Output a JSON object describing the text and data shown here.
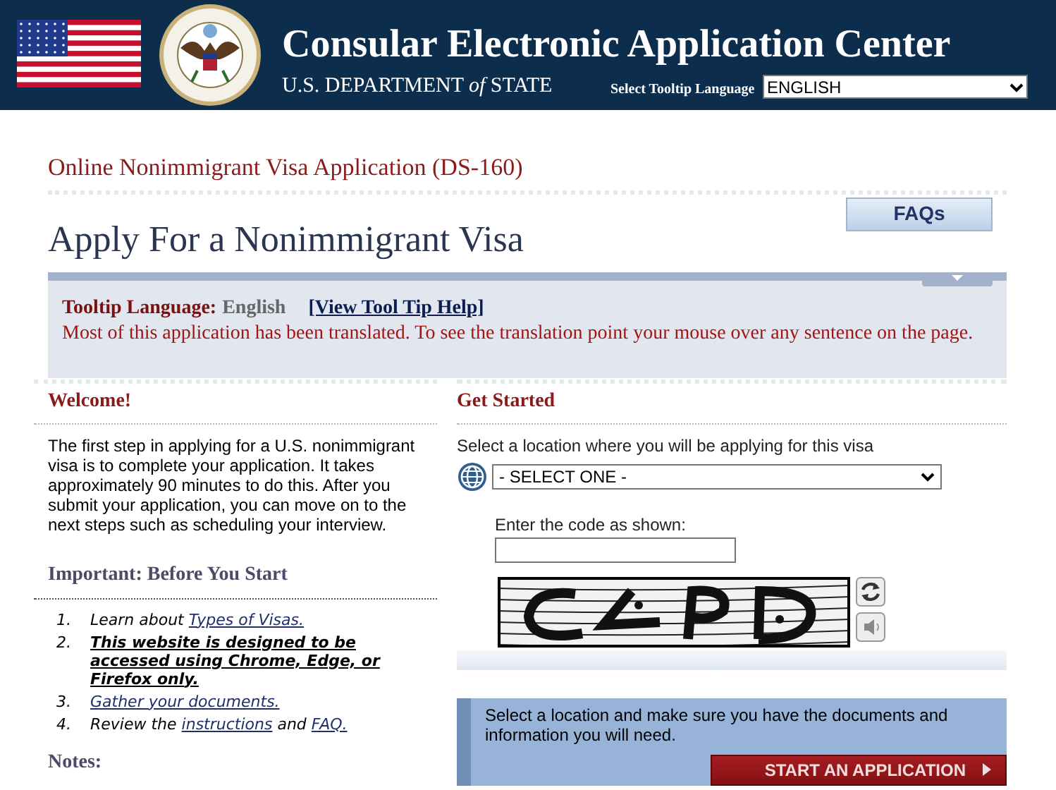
{
  "header": {
    "title": "Consular Electronic Application Center",
    "subtitle": "U.S. DEPARTMENT *of* STATE",
    "language_label": "Select Tooltip Language",
    "language_select": "ENGLISH"
  },
  "breadcrumb": "Online Nonimmigrant Visa Application (DS-160)",
  "page_title": "Apply For a Nonimmigrant Visa",
  "faqs_button": "FAQs",
  "tooltip_panel": {
    "label": "Tooltip Language:",
    "value": "English",
    "help_link": "[View Tool Tip Help]",
    "message": "Most of this application has been translated. To see the translation point your mouse over any sentence on the page."
  },
  "welcome": {
    "heading": "Welcome!",
    "text": "The first step in applying for a U.S. nonimmigrant visa is to complete your application. It takes approximately 90 minutes to do this. After you submit your application, you can move on to the next steps such as scheduling your interview.",
    "important_heading": "Important: Before You Start",
    "steps": [
      {
        "number": "1.",
        "parts": [
          {
            "kind": "text",
            "text": "Learn about "
          },
          {
            "kind": "link",
            "text": "Types of Visas."
          }
        ]
      },
      {
        "number": "2.",
        "parts": [
          {
            "kind": "bold_link",
            "text": "This website is designed to be accessed using Chrome, Edge, or Firefox only."
          }
        ]
      },
      {
        "number": "3.",
        "parts": [
          {
            "kind": "link",
            "text": "Gather your documents."
          }
        ]
      },
      {
        "number": "4.",
        "parts": [
          {
            "kind": "text",
            "text": "Review the "
          },
          {
            "kind": "link",
            "text": "instructions"
          },
          {
            "kind": "text",
            "text": " and "
          },
          {
            "kind": "link",
            "text": "FAQ."
          }
        ]
      }
    ],
    "notes_heading": "Notes:"
  },
  "get_started": {
    "heading": "Get Started",
    "location_label": "Select a location where you will be applying for this visa",
    "location_select": "- SELECT ONE -",
    "code_label": "Enter the code as shown:",
    "start_text": "Select a location and make sure you have the documents and information you will need.",
    "start_button": "START AN APPLICATION"
  }
}
